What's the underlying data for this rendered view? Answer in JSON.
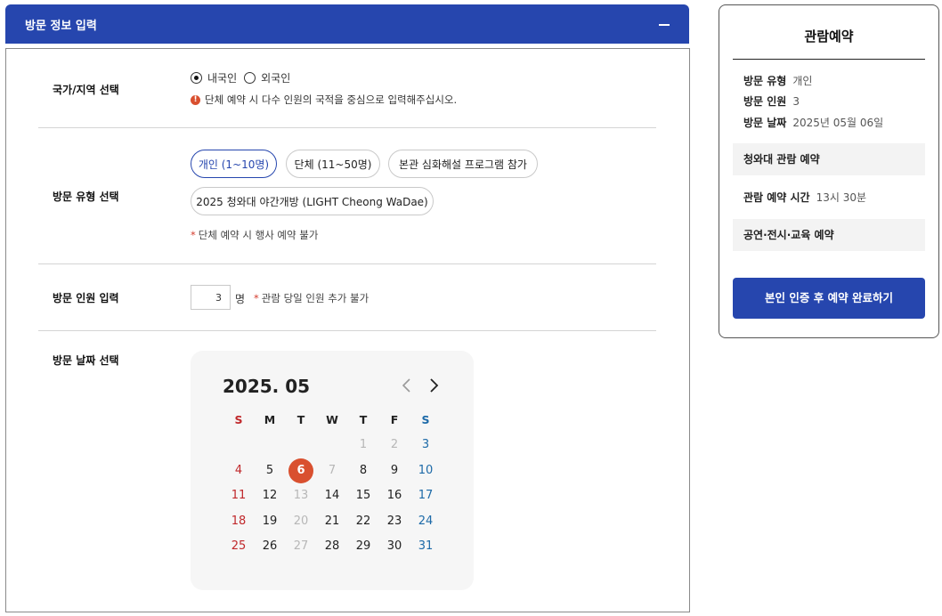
{
  "section": {
    "title": "방문 정보 입력",
    "collapse_symbol": "−"
  },
  "nationality": {
    "label": "국가/지역 선택",
    "options": [
      "내국인",
      "외국인"
    ],
    "selected": "내국인",
    "notice_icon": "!",
    "notice": "단체 예약 시 다수 인원의 국적을 중심으로 입력해주십시오."
  },
  "visit_type": {
    "label": "방문 유형 선택",
    "options": [
      "개인 (1~10명)",
      "단체 (11~50명)",
      "본관 심화해설 프로그램 참가",
      "2025 청와대 야간개방 (LIGHT Cheong WaDae)"
    ],
    "selected": "개인 (1~10명)",
    "note_star": "*",
    "note": "단체 예약 시 행사 예약 불가"
  },
  "visitor_count": {
    "label": "방문 인원 입력",
    "value": "3",
    "unit": "명",
    "note_star": "*",
    "note": "관람 당일 인원 추가 불가"
  },
  "visit_date": {
    "label": "방문 날짜 선택",
    "calendar": {
      "month_title": "2025. 05",
      "weekdays": [
        "S",
        "M",
        "T",
        "W",
        "T",
        "F",
        "S"
      ],
      "weeks": [
        [
          "",
          "",
          "",
          "",
          "1",
          "2",
          "3"
        ],
        [
          "4",
          "5",
          "6",
          "7",
          "8",
          "9",
          "10"
        ],
        [
          "11",
          "12",
          "13",
          "14",
          "15",
          "16",
          "17"
        ],
        [
          "18",
          "19",
          "20",
          "21",
          "22",
          "23",
          "24"
        ],
        [
          "25",
          "26",
          "27",
          "28",
          "29",
          "30",
          "31"
        ]
      ],
      "selected_day": "6",
      "disabled_days": [
        "1",
        "2",
        "7",
        "13",
        "20",
        "27"
      ],
      "sunday_color": "#c0282b",
      "saturday_color": "#1d6aa8",
      "selected_color": "#d9502f"
    }
  },
  "summary": {
    "title": "관람예약",
    "rows": [
      {
        "key": "방문 유형",
        "value": "개인"
      },
      {
        "key": "방문 인원",
        "value": "3"
      },
      {
        "key": "방문 날짜",
        "value": "2025년 05월 06일"
      }
    ],
    "band_1": "청와대 관람 예약",
    "time_key": "관람 예약 시간",
    "time_value": "13시 30분",
    "band_2": "공연·전시·교육 예약",
    "submit_label": "본인 인증 후 예약 완료하기",
    "accent_color": "#2646ae"
  }
}
